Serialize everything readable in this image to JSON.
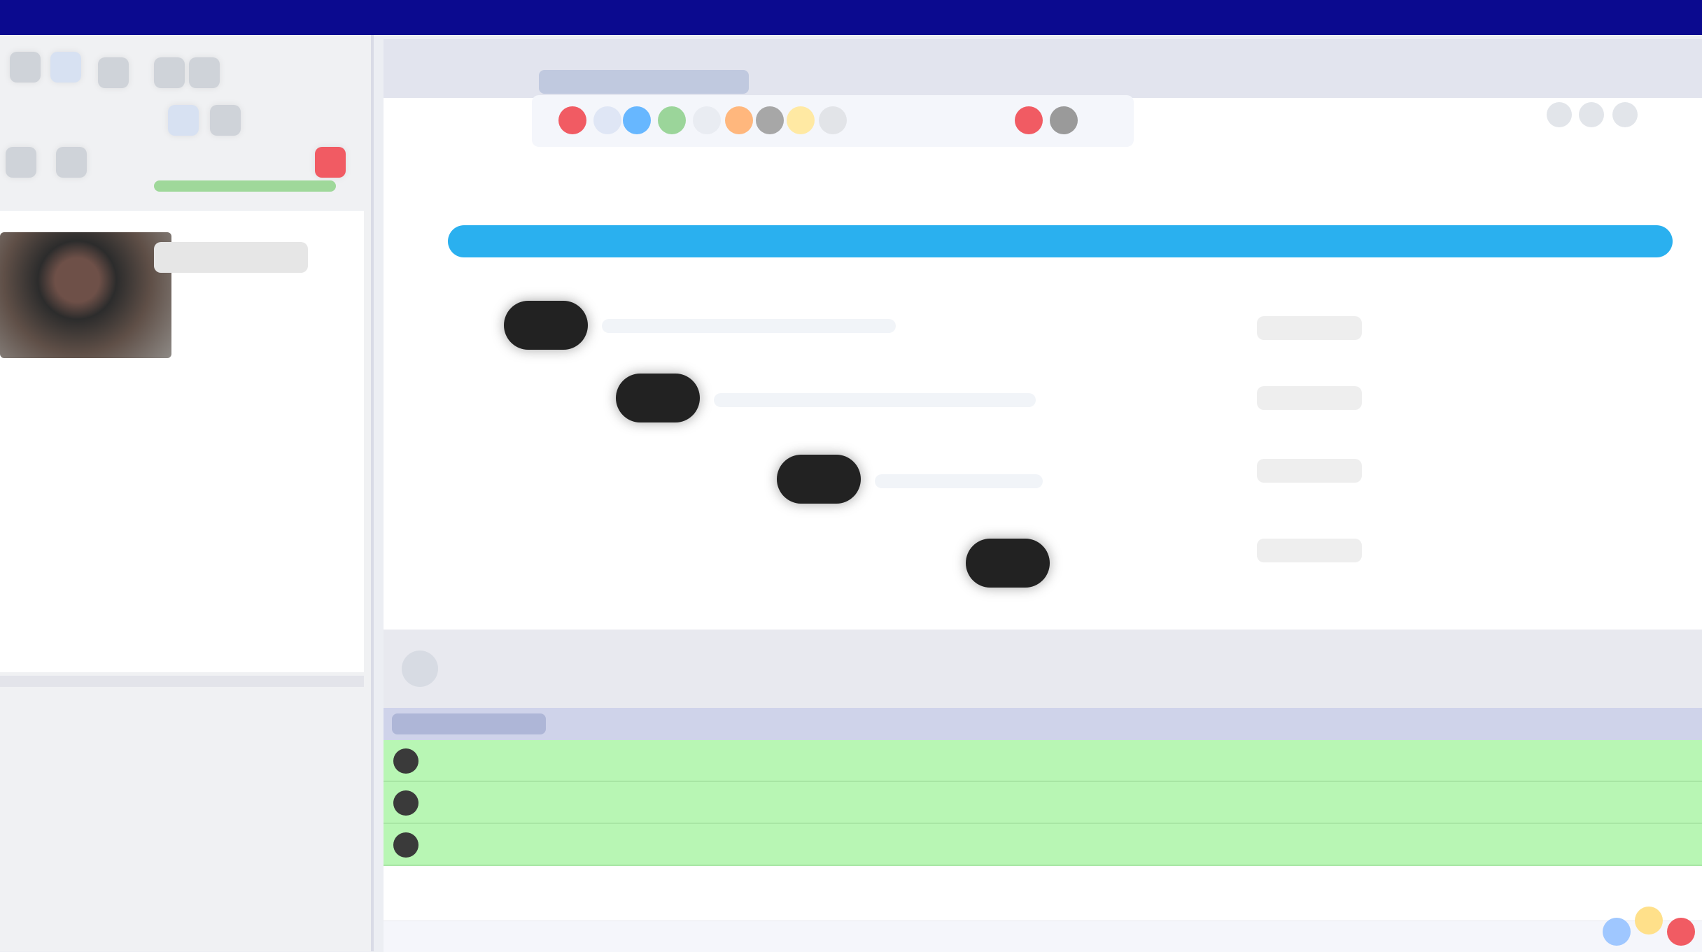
{
  "titlebar": {
    "left_text": "",
    "right_text": ""
  },
  "left": {
    "name_field": ""
  },
  "main": {
    "events": [
      {
        "time": ""
      },
      {
        "time": ""
      },
      {
        "time": ""
      },
      {
        "time": ""
      }
    ],
    "table": {
      "rows": [
        {
          "col1": "",
          "col2": ""
        },
        {
          "col1": "",
          "col2": ""
        },
        {
          "col1": "",
          "col2": ""
        }
      ]
    }
  },
  "colors": {
    "titlebar": "#0b0a8f",
    "progress": "#2ab0ef",
    "row_green": "#b8f6b4",
    "alert_red": "#f15b63"
  },
  "icons": {
    "toolbar": [
      "stop-icon",
      "folder-icon",
      "play-icon",
      "refresh-icon",
      "document-icon",
      "target-icon",
      "gear-icon",
      "warning-icon",
      "link-icon",
      "close-icon",
      "help-icon"
    ],
    "left_toolbar": [
      "new-icon",
      "open-icon",
      "save-icon",
      "play-icon",
      "pause-icon",
      "settings-icon",
      "camera-icon",
      "alert-icon"
    ]
  }
}
